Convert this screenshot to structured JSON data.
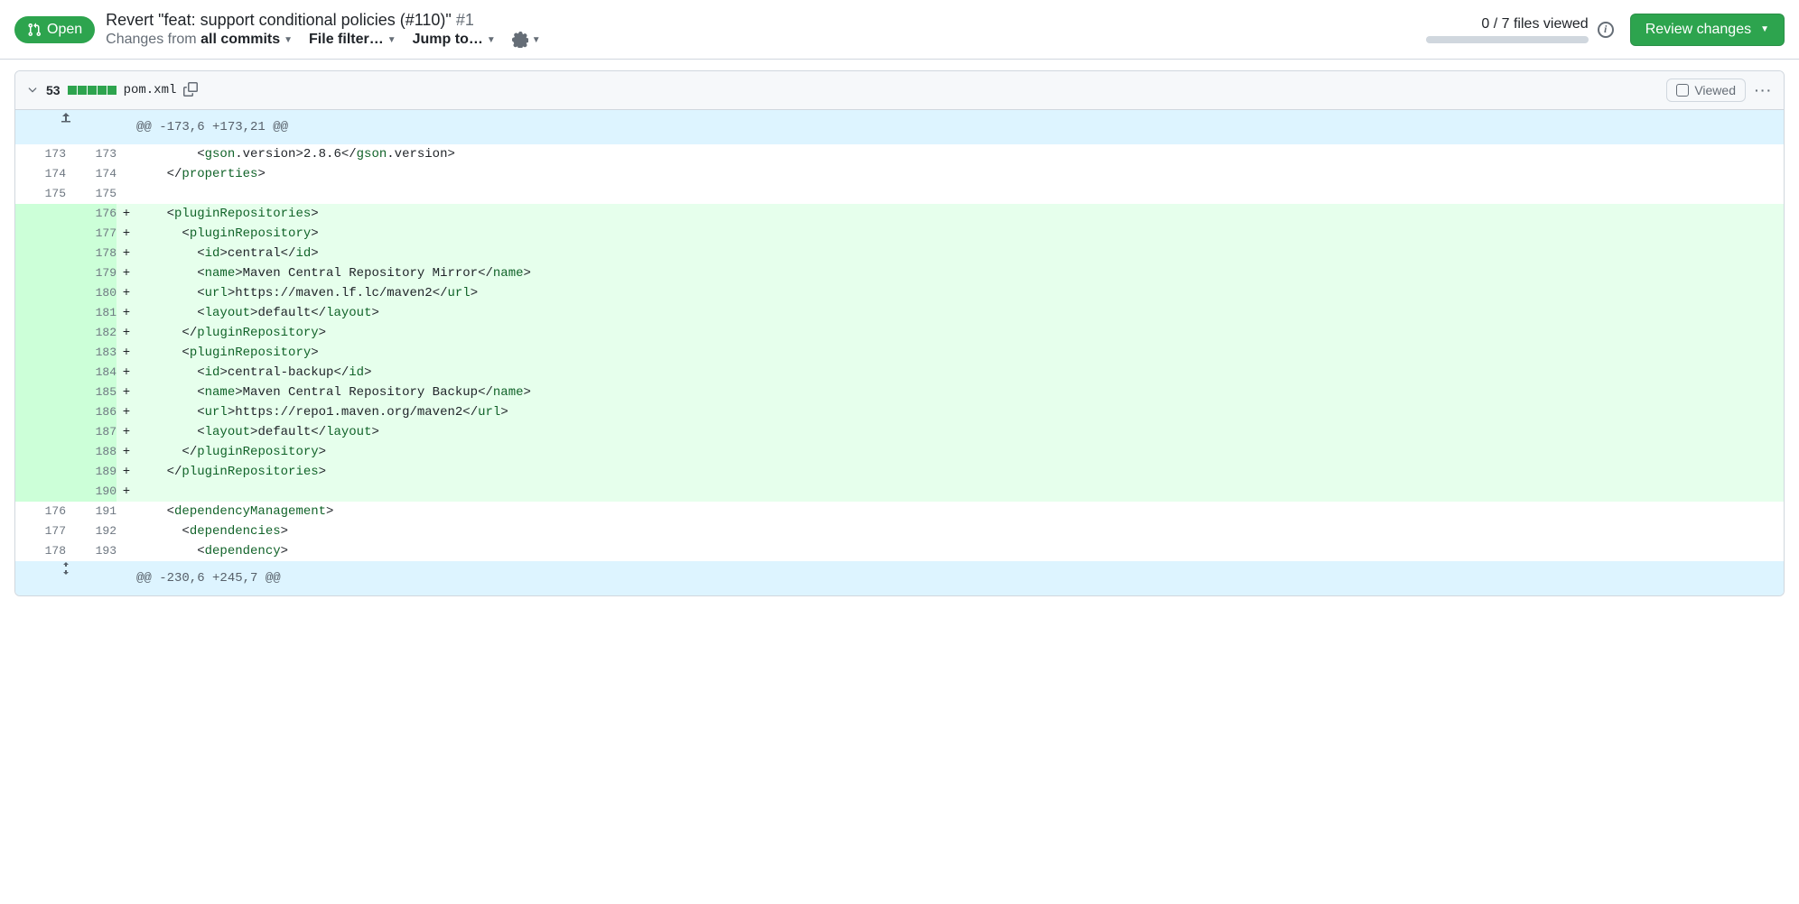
{
  "header": {
    "state": "Open",
    "title": "Revert \"feat: support conditional policies (#110)\"",
    "pr_number": "#1",
    "changes_from_label": "Changes from",
    "changes_from_value": "all commits",
    "file_filter_label": "File filter…",
    "jump_to_label": "Jump to…",
    "files_viewed": "0 / 7 files viewed",
    "review_button": "Review changes"
  },
  "file": {
    "line_count": "53",
    "filename": "pom.xml",
    "viewed_label": "Viewed"
  },
  "hunks": [
    {
      "type": "hunk",
      "expand": "up",
      "text": "@@ -173,6 +173,21 @@"
    },
    {
      "type": "ctx",
      "old": "173",
      "new": "173",
      "indent": "        ",
      "segments": [
        [
          "pun",
          "<"
        ],
        [
          "tag",
          "gson"
        ],
        [
          "txt",
          ".version>2.8.6</"
        ],
        [
          "tag",
          "gson"
        ],
        [
          "txt",
          ".version>"
        ]
      ]
    },
    {
      "type": "ctx",
      "old": "174",
      "new": "174",
      "indent": "    ",
      "segments": [
        [
          "pun",
          "</"
        ],
        [
          "tag",
          "properties"
        ],
        [
          "pun",
          ">"
        ]
      ]
    },
    {
      "type": "ctx",
      "old": "175",
      "new": "175",
      "indent": "",
      "segments": []
    },
    {
      "type": "add",
      "new": "176",
      "indent": "    ",
      "segments": [
        [
          "pun",
          "<"
        ],
        [
          "tag",
          "pluginRepositories"
        ],
        [
          "pun",
          ">"
        ]
      ]
    },
    {
      "type": "add",
      "new": "177",
      "indent": "      ",
      "segments": [
        [
          "pun",
          "<"
        ],
        [
          "tag",
          "pluginRepository"
        ],
        [
          "pun",
          ">"
        ]
      ]
    },
    {
      "type": "add",
      "new": "178",
      "indent": "        ",
      "segments": [
        [
          "pun",
          "<"
        ],
        [
          "tag",
          "id"
        ],
        [
          "pun",
          ">"
        ],
        [
          "txt",
          "central"
        ],
        [
          "pun",
          "</"
        ],
        [
          "tag",
          "id"
        ],
        [
          "pun",
          ">"
        ]
      ]
    },
    {
      "type": "add",
      "new": "179",
      "indent": "        ",
      "segments": [
        [
          "pun",
          "<"
        ],
        [
          "tag",
          "name"
        ],
        [
          "pun",
          ">"
        ],
        [
          "txt",
          "Maven Central Repository Mirror"
        ],
        [
          "pun",
          "</"
        ],
        [
          "tag",
          "name"
        ],
        [
          "pun",
          ">"
        ]
      ]
    },
    {
      "type": "add",
      "new": "180",
      "indent": "        ",
      "segments": [
        [
          "pun",
          "<"
        ],
        [
          "tag",
          "url"
        ],
        [
          "pun",
          ">"
        ],
        [
          "txt",
          "https://maven.lf.lc/maven2"
        ],
        [
          "pun",
          "</"
        ],
        [
          "tag",
          "url"
        ],
        [
          "pun",
          ">"
        ]
      ]
    },
    {
      "type": "add",
      "new": "181",
      "indent": "        ",
      "segments": [
        [
          "pun",
          "<"
        ],
        [
          "tag",
          "layout"
        ],
        [
          "pun",
          ">"
        ],
        [
          "txt",
          "default"
        ],
        [
          "pun",
          "</"
        ],
        [
          "tag",
          "layout"
        ],
        [
          "pun",
          ">"
        ]
      ]
    },
    {
      "type": "add",
      "new": "182",
      "indent": "      ",
      "segments": [
        [
          "pun",
          "</"
        ],
        [
          "tag",
          "pluginRepository"
        ],
        [
          "pun",
          ">"
        ]
      ]
    },
    {
      "type": "add",
      "new": "183",
      "indent": "      ",
      "segments": [
        [
          "pun",
          "<"
        ],
        [
          "tag",
          "pluginRepository"
        ],
        [
          "pun",
          ">"
        ]
      ]
    },
    {
      "type": "add",
      "new": "184",
      "indent": "        ",
      "segments": [
        [
          "pun",
          "<"
        ],
        [
          "tag",
          "id"
        ],
        [
          "pun",
          ">"
        ],
        [
          "txt",
          "central-backup"
        ],
        [
          "pun",
          "</"
        ],
        [
          "tag",
          "id"
        ],
        [
          "pun",
          ">"
        ]
      ]
    },
    {
      "type": "add",
      "new": "185",
      "indent": "        ",
      "segments": [
        [
          "pun",
          "<"
        ],
        [
          "tag",
          "name"
        ],
        [
          "pun",
          ">"
        ],
        [
          "txt",
          "Maven Central Repository Backup"
        ],
        [
          "pun",
          "</"
        ],
        [
          "tag",
          "name"
        ],
        [
          "pun",
          ">"
        ]
      ]
    },
    {
      "type": "add",
      "new": "186",
      "indent": "        ",
      "segments": [
        [
          "pun",
          "<"
        ],
        [
          "tag",
          "url"
        ],
        [
          "pun",
          ">"
        ],
        [
          "txt",
          "https://repo1.maven.org/maven2"
        ],
        [
          "pun",
          "</"
        ],
        [
          "tag",
          "url"
        ],
        [
          "pun",
          ">"
        ]
      ]
    },
    {
      "type": "add",
      "new": "187",
      "indent": "        ",
      "segments": [
        [
          "pun",
          "<"
        ],
        [
          "tag",
          "layout"
        ],
        [
          "pun",
          ">"
        ],
        [
          "txt",
          "default"
        ],
        [
          "pun",
          "</"
        ],
        [
          "tag",
          "layout"
        ],
        [
          "pun",
          ">"
        ]
      ]
    },
    {
      "type": "add",
      "new": "188",
      "indent": "      ",
      "segments": [
        [
          "pun",
          "</"
        ],
        [
          "tag",
          "pluginRepository"
        ],
        [
          "pun",
          ">"
        ]
      ]
    },
    {
      "type": "add",
      "new": "189",
      "indent": "    ",
      "segments": [
        [
          "pun",
          "</"
        ],
        [
          "tag",
          "pluginRepositories"
        ],
        [
          "pun",
          ">"
        ]
      ]
    },
    {
      "type": "add",
      "new": "190",
      "indent": "",
      "segments": []
    },
    {
      "type": "ctx",
      "old": "176",
      "new": "191",
      "indent": "    ",
      "segments": [
        [
          "pun",
          "<"
        ],
        [
          "tag",
          "dependencyManagement"
        ],
        [
          "pun",
          ">"
        ]
      ]
    },
    {
      "type": "ctx",
      "old": "177",
      "new": "192",
      "indent": "      ",
      "segments": [
        [
          "pun",
          "<"
        ],
        [
          "tag",
          "dependencies"
        ],
        [
          "pun",
          ">"
        ]
      ]
    },
    {
      "type": "ctx",
      "old": "178",
      "new": "193",
      "indent": "        ",
      "segments": [
        [
          "pun",
          "<"
        ],
        [
          "tag",
          "dependency"
        ],
        [
          "pun",
          ">"
        ]
      ]
    },
    {
      "type": "hunk",
      "expand": "both",
      "text": "@@ -230,6 +245,7 @@"
    }
  ]
}
